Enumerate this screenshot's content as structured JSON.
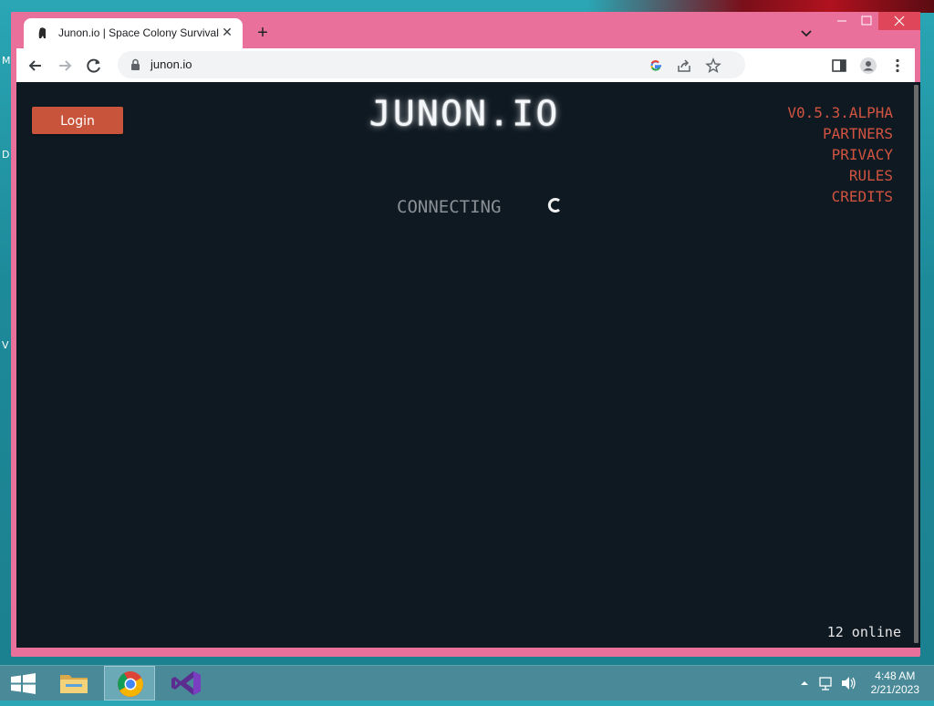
{
  "desktop": {
    "left_letters": [
      "M",
      "D",
      "V"
    ]
  },
  "browser": {
    "tab_title": "Junon.io | Space Colony Survival",
    "address": "junon.io"
  },
  "page": {
    "login_label": "Login",
    "game_title": "JUNON.IO",
    "links": [
      "V0.5.3.ALPHA",
      "PARTNERS",
      "PRIVACY",
      "RULES",
      "CREDITS"
    ],
    "status": "CONNECTING",
    "online_count": "12 online"
  },
  "colors": {
    "window_frame": "#e8709a",
    "page_background": "#0f1922",
    "login_button": "#c8553b",
    "link_color": "#d05440"
  },
  "taskbar": {
    "apps": [
      "windows-start",
      "file-explorer",
      "chrome",
      "visual-studio"
    ],
    "time": "4:48 AM",
    "date": "2/21/2023"
  }
}
